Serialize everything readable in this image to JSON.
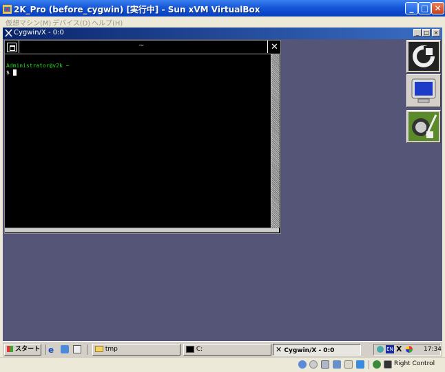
{
  "host_window": {
    "title": "2K_Pro (before_cygwin) [実行中] - Sun xVM VirtualBox",
    "menu": [
      "仮想マシン(M)",
      "デバイス(D)",
      "ヘルプ(H)"
    ],
    "minimize_glyph": "_",
    "maximize_glyph": "□",
    "close_glyph": "✕"
  },
  "cygwin_x_window": {
    "title": "Cygwin/X - 0:0",
    "buttons": {
      "minimize": "_",
      "maximize": "□",
      "close": "×"
    }
  },
  "xterm": {
    "title": "~",
    "close_glyph": "✕",
    "prompt_user": "Administrator@v2k ~",
    "prompt": "$"
  },
  "dock_icons": [
    "cygwin-logo-icon",
    "monitor-icon",
    "x-app-icon"
  ],
  "taskbar": {
    "start_label": "スタート",
    "buttons": [
      {
        "label": "tmp"
      },
      {
        "label": "C:"
      },
      {
        "label": "Cygwin/X - 0:0"
      }
    ],
    "tray": {
      "lang": "EN",
      "time": "17:34"
    }
  },
  "status_bar": {
    "host_key": "Right Control"
  },
  "colors": {
    "guest_desktop": "#555577",
    "terminal_bg": "#000000",
    "prompt_green": "#2ad42a",
    "xp_title_blue": "#0a46c8"
  }
}
